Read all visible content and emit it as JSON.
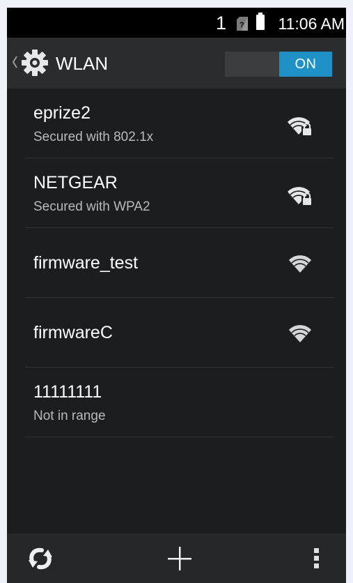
{
  "status_bar": {
    "notification_count": "1",
    "sim_icon": "sim-unknown-icon",
    "battery_icon": "battery-full-icon",
    "time": "11:06 AM"
  },
  "action_bar": {
    "back_icon": "chevron-left-icon",
    "settings_icon": "gear-icon",
    "title": "WLAN",
    "toggle_label": "ON"
  },
  "networks": [
    {
      "ssid": "eprize2",
      "status": "Secured with 802.1x",
      "signal_icon": "wifi-secured-icon"
    },
    {
      "ssid": "NETGEAR",
      "status": "Secured with WPA2",
      "signal_icon": "wifi-secured-icon"
    },
    {
      "ssid": "firmware_test",
      "status": "",
      "signal_icon": "wifi-open-icon"
    },
    {
      "ssid": "firmwareC",
      "status": "",
      "signal_icon": "wifi-open-icon"
    },
    {
      "ssid": "11111111",
      "status": "Not in range",
      "signal_icon": ""
    }
  ],
  "bottom_bar": {
    "left_icon": "refresh-icon",
    "center_icon": "add-icon",
    "right_icon": "overflow-menu-icon"
  },
  "colors": {
    "accent": "#1f91c7",
    "background": "#1b1d1f",
    "status_bar": "#000000"
  }
}
